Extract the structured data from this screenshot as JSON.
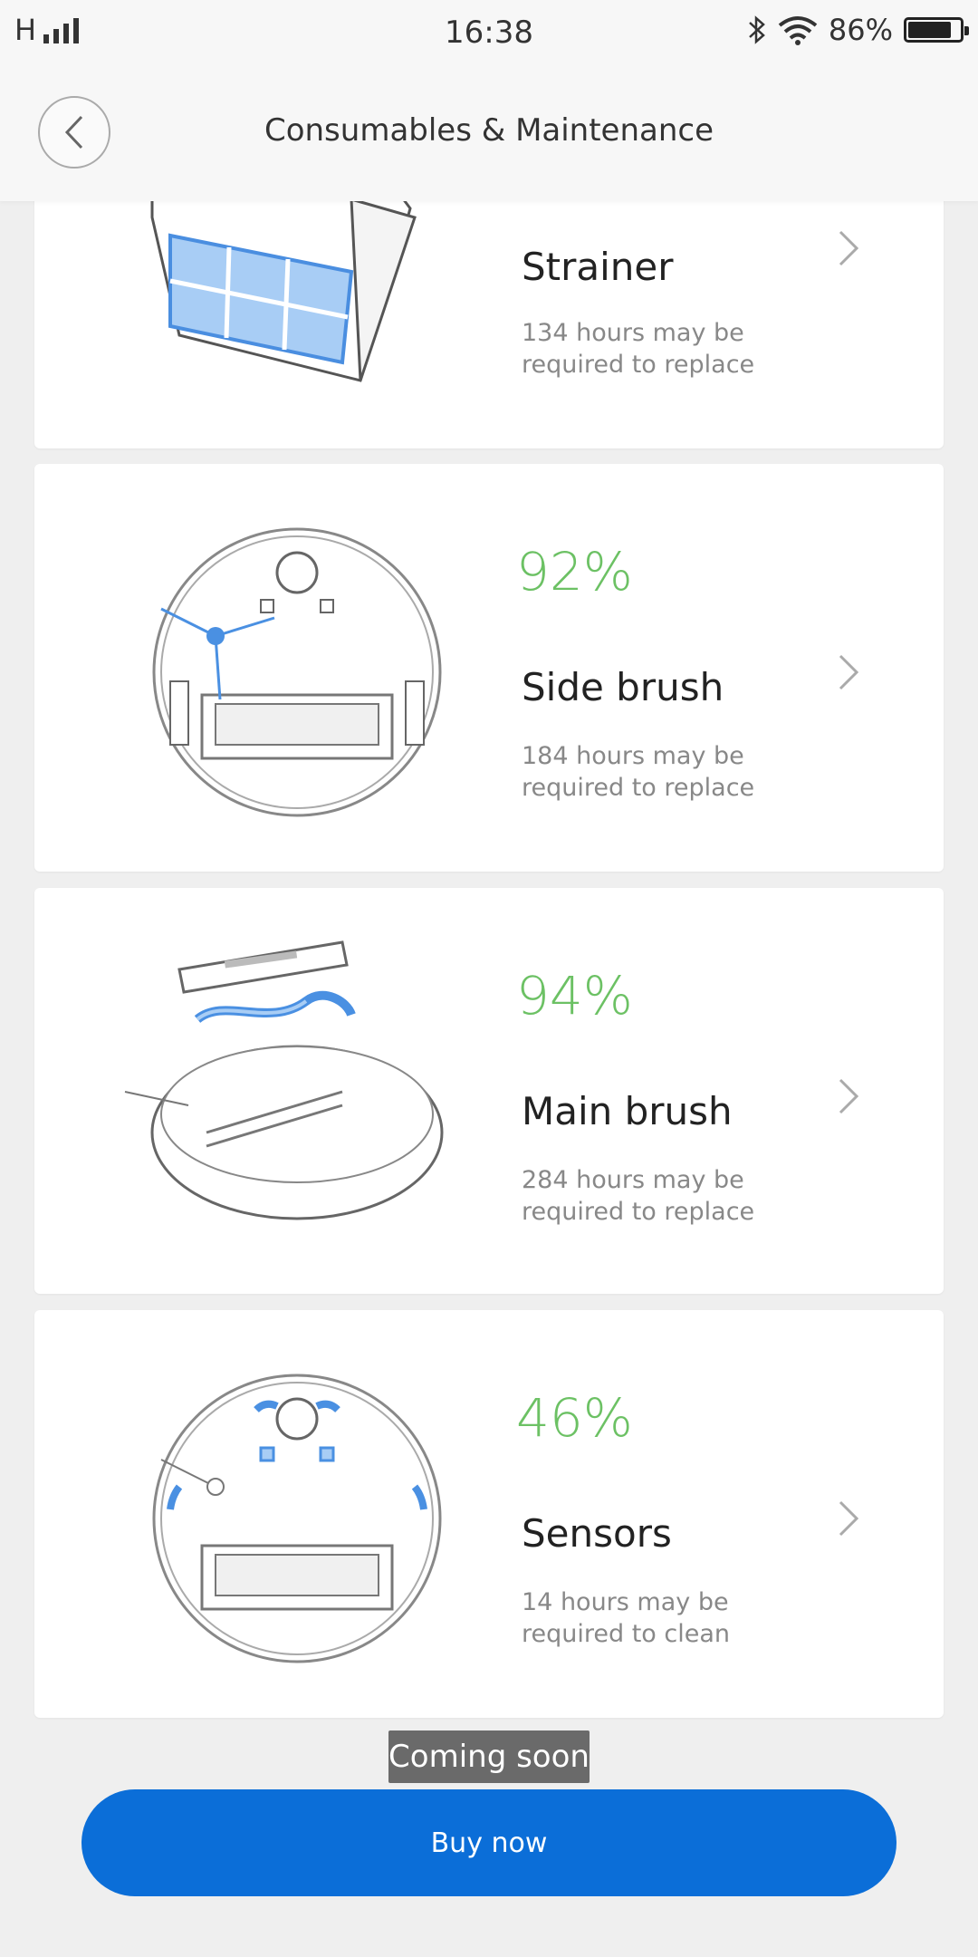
{
  "status_bar": {
    "network": "H",
    "time": "16:38",
    "battery": "86%"
  },
  "header": {
    "title": "Consumables & Maintenance"
  },
  "items": [
    {
      "percent": "",
      "name": "Strainer",
      "hours": "134 hours may be",
      "action": "required to replace",
      "icon": "strainer-illustration"
    },
    {
      "percent": "92%",
      "name": "Side brush",
      "hours": "184 hours may be",
      "action": "required to replace",
      "icon": "side-brush-illustration"
    },
    {
      "percent": "94%",
      "name": "Main brush",
      "hours": "284 hours may be",
      "action": "required to replace",
      "icon": "main-brush-illustration"
    },
    {
      "percent": "46%",
      "name": "Sensors",
      "hours": "14 hours may be",
      "action": "required to clean",
      "icon": "sensors-illustration"
    }
  ],
  "toast": "Coming soon",
  "buy_button": "Buy now",
  "colors": {
    "percent": "#6cc164",
    "primary": "#0b6ed8",
    "accent_blue": "#4a90e2"
  }
}
